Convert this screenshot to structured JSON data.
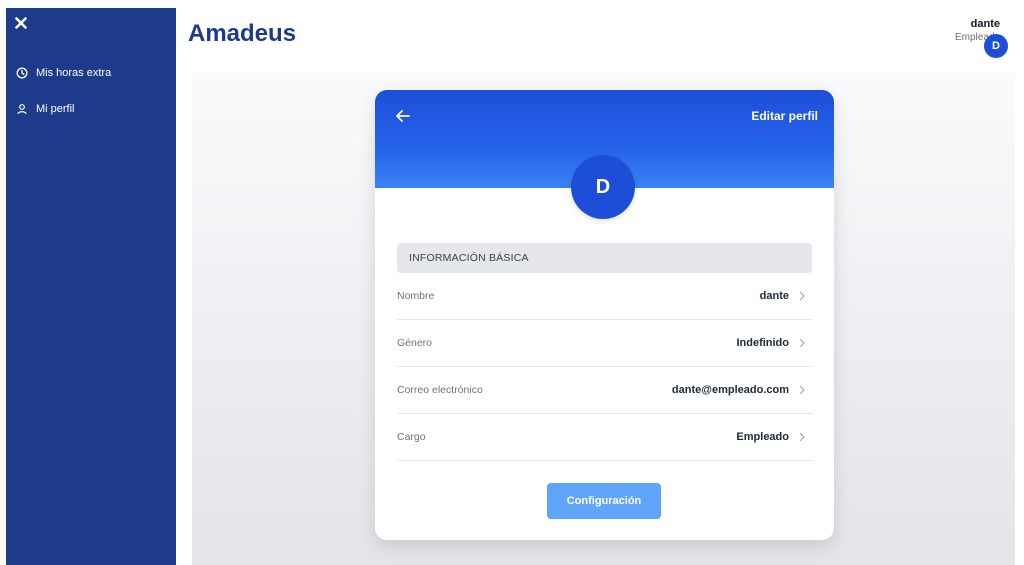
{
  "sidebar": {
    "items": [
      {
        "label": "Mis horas extra",
        "icon": "clock-icon"
      },
      {
        "label": "Mi perfil",
        "icon": "user-icon"
      }
    ]
  },
  "header": {
    "brand": "Amadeus",
    "user": {
      "name": "dante",
      "role": "Empleado",
      "avatar_initial": "D"
    }
  },
  "profile": {
    "edit_label": "Editar perfil",
    "avatar_initial": "D",
    "section_title": "INFORMACIÓN BÁSICA",
    "fields": [
      {
        "label": "Nombre",
        "value": "dante"
      },
      {
        "label": "Género",
        "value": "Indefinido"
      },
      {
        "label": "Correo electrónico",
        "value": "dante@empleado.com"
      },
      {
        "label": "Cargo",
        "value": "Empleado"
      }
    ],
    "config_button": "Configuración"
  },
  "colors": {
    "sidebar": "#1e3a8a",
    "brand": "#1e3a8a",
    "header_gradient_top": "#1d4ed8",
    "header_gradient_bottom": "#3b82f6",
    "button": "#60a5fa"
  }
}
